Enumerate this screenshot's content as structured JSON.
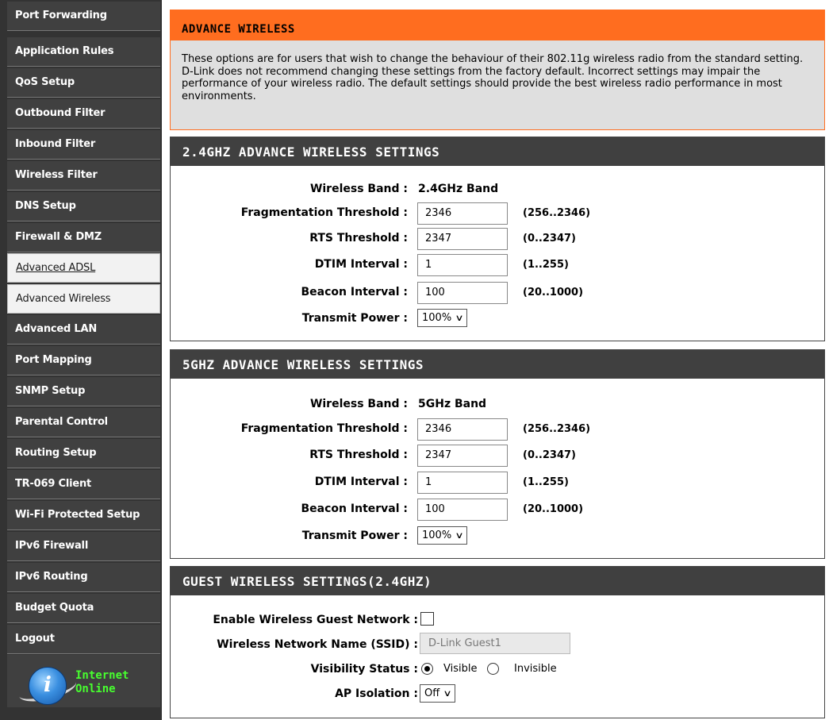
{
  "sidebar": {
    "items": [
      {
        "label": "Port Forwarding"
      },
      {
        "label": "Application Rules"
      },
      {
        "label": "QoS Setup"
      },
      {
        "label": "Outbound Filter"
      },
      {
        "label": "Inbound Filter"
      },
      {
        "label": "Wireless Filter"
      },
      {
        "label": "DNS Setup"
      },
      {
        "label": "Firewall & DMZ"
      },
      {
        "label": "Advanced ADSL"
      },
      {
        "label": "Advanced Wireless"
      },
      {
        "label": "Advanced LAN"
      },
      {
        "label": "Port Mapping"
      },
      {
        "label": "SNMP Setup"
      },
      {
        "label": "Parental Control"
      },
      {
        "label": "Routing Setup"
      },
      {
        "label": "TR-069 Client"
      },
      {
        "label": "Wi-Fi Protected Setup"
      },
      {
        "label": "IPv6 Firewall"
      },
      {
        "label": "IPv6 Routing"
      },
      {
        "label": "Budget Quota"
      },
      {
        "label": "Logout"
      }
    ],
    "status": {
      "line1": "Internet",
      "line2": "Online",
      "icon": "info-globe-icon",
      "icon_glyph": "i"
    }
  },
  "advance_wireless": {
    "title": "ADVANCE WIRELESS",
    "description": "These options are for users that wish to change the behaviour of their 802.11g wireless radio from the standard setting. D-Link does not recommend changing these settings from the factory default. Incorrect settings may impair the performance of your wireless radio. The default settings should provide the best wireless radio performance in most environments."
  },
  "settings_24": {
    "title": "2.4GHZ ADVANCE WIRELESS SETTINGS",
    "wireless_band_label": "Wireless Band :",
    "wireless_band_value": "2.4GHz Band",
    "frag_label": "Fragmentation Threshold :",
    "frag_value": "2346",
    "frag_range": "(256..2346)",
    "rts_label": "RTS Threshold :",
    "rts_value": "2347",
    "rts_range": "(0..2347)",
    "dtim_label": "DTIM Interval :",
    "dtim_value": "1",
    "dtim_range": "(1..255)",
    "beacon_label": "Beacon Interval :",
    "beacon_value": "100",
    "beacon_range": "(20..1000)",
    "power_label": "Transmit Power :",
    "power_value": "100%"
  },
  "settings_5": {
    "title": "5GHZ ADVANCE WIRELESS SETTINGS",
    "wireless_band_label": "Wireless Band :",
    "wireless_band_value": "5GHz Band",
    "frag_label": "Fragmentation Threshold :",
    "frag_value": "2346",
    "frag_range": "(256..2346)",
    "rts_label": "RTS Threshold :",
    "rts_value": "2347",
    "rts_range": "(0..2347)",
    "dtim_label": "DTIM Interval :",
    "dtim_value": "1",
    "dtim_range": "(1..255)",
    "beacon_label": "Beacon Interval :",
    "beacon_value": "100",
    "beacon_range": "(20..1000)",
    "power_label": "Transmit Power :",
    "power_value": "100%"
  },
  "guest": {
    "title": "GUEST WIRELESS SETTINGS(2.4GHZ)",
    "enable_label": "Enable Wireless Guest Network :",
    "enable_checked": false,
    "ssid_label": "Wireless Network Name (SSID) :",
    "ssid_value": "D-Link Guest1",
    "visibility_label": "Visibility Status :",
    "visible_label": "Visible",
    "invisible_label": "Invisible",
    "visibility_selected": "Visible",
    "isolation_label": "AP Isolation :",
    "isolation_value": "Off"
  },
  "colors": {
    "accent": "#ff6d1f",
    "sidebar_bg": "#404040",
    "status_green": "#47ff2f"
  }
}
